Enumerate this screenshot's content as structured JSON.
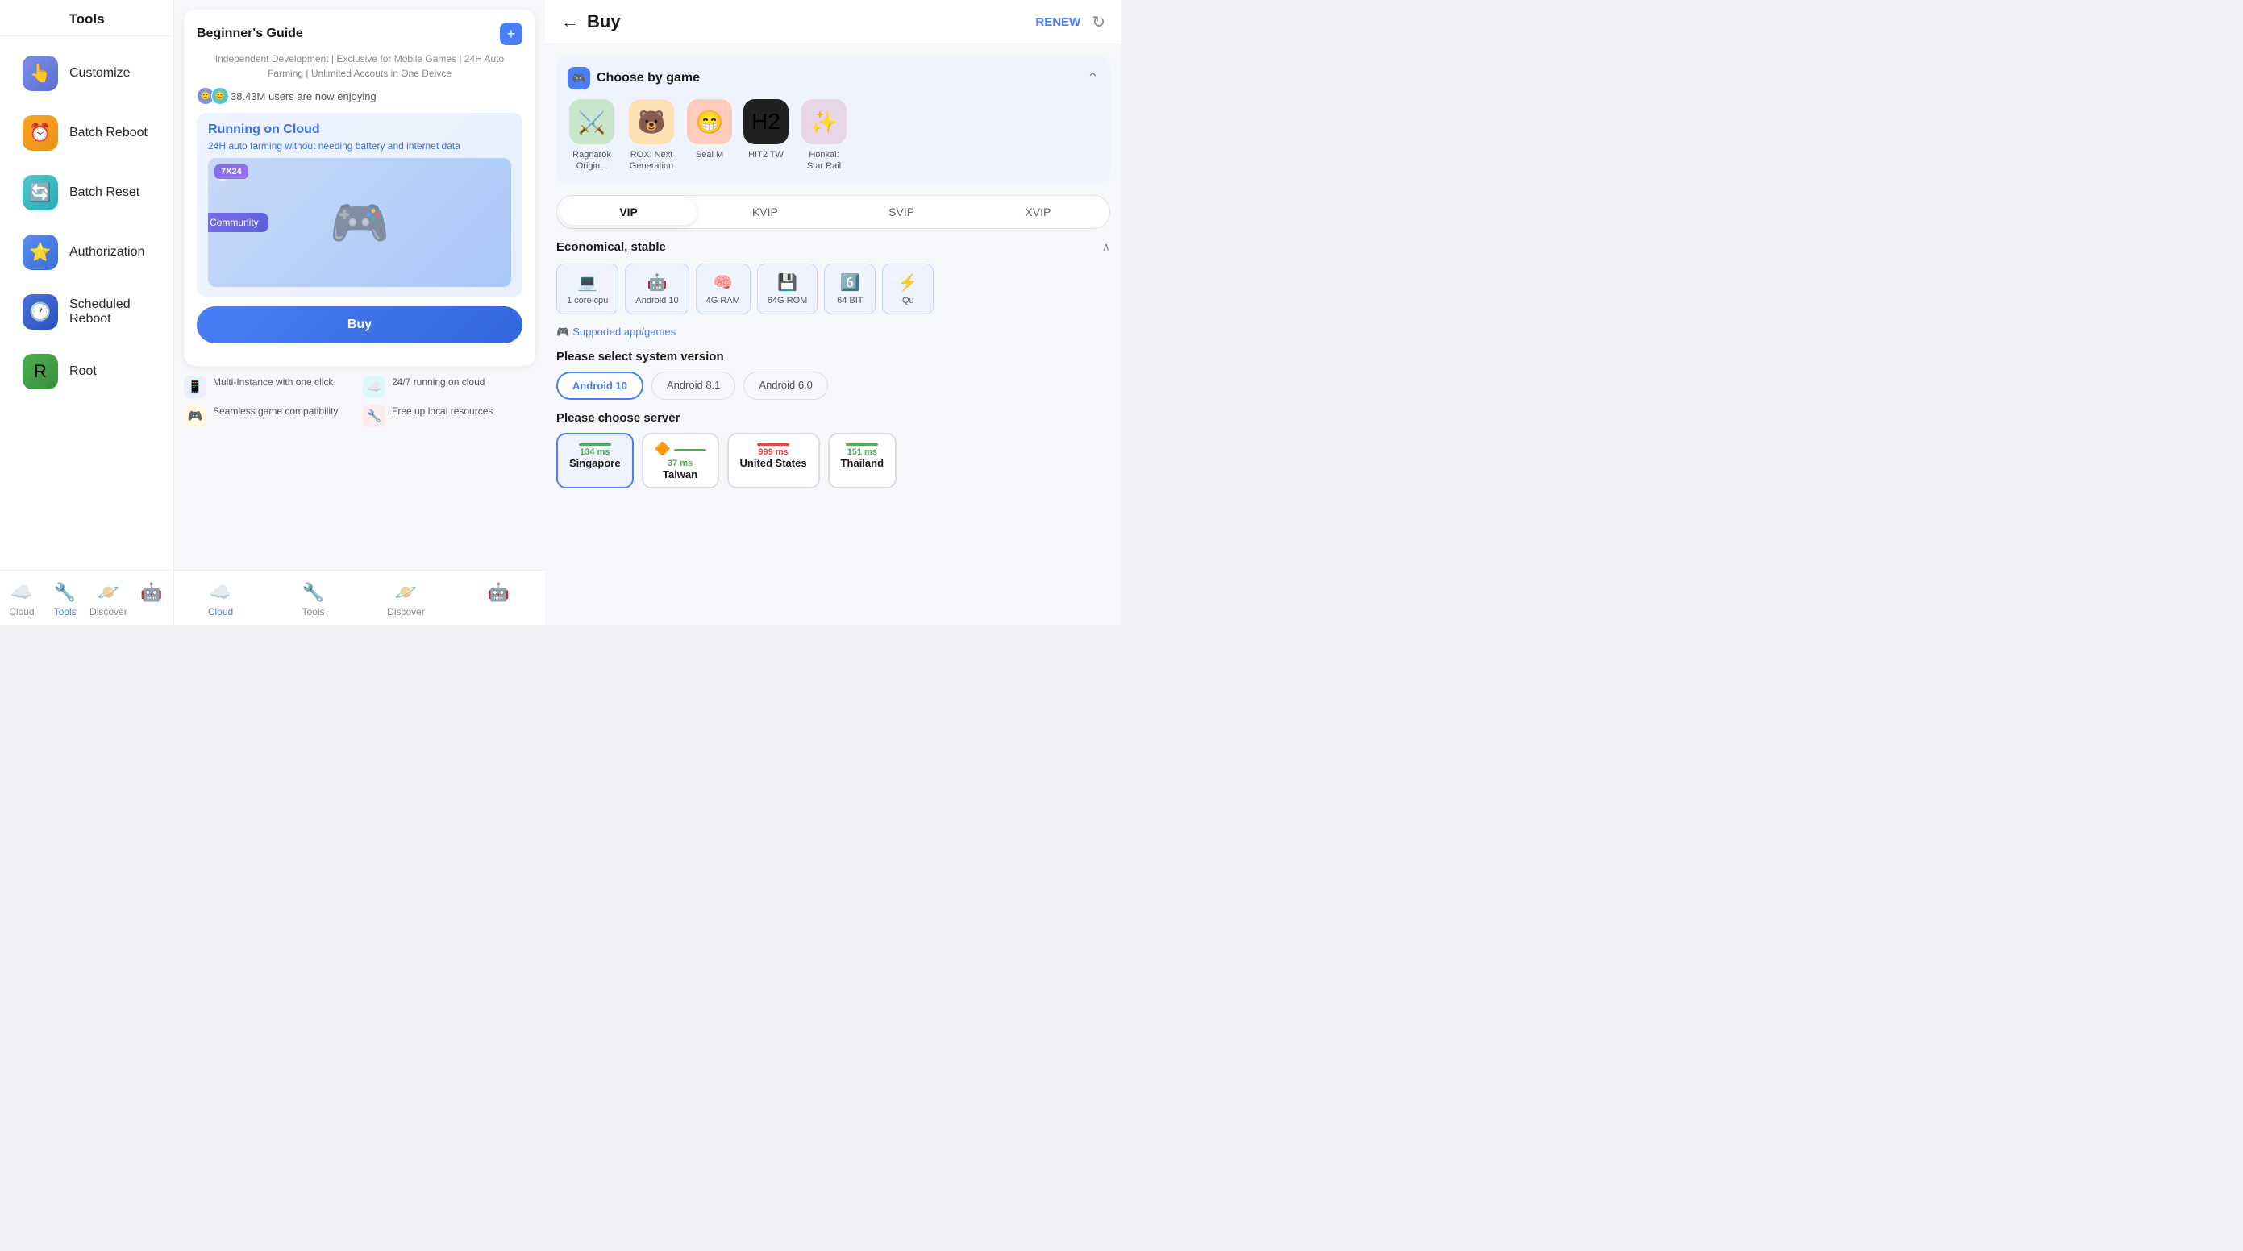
{
  "left": {
    "title": "Tools",
    "tools": [
      {
        "id": "customize",
        "label": "Customize",
        "icon": "👆",
        "iconClass": "blue-purple"
      },
      {
        "id": "batch-reboot",
        "label": "Batch Reboot",
        "icon": "⏰",
        "iconClass": "yellow"
      },
      {
        "id": "batch-reset",
        "label": "Batch Reset",
        "icon": "🔄",
        "iconClass": "teal"
      },
      {
        "id": "authorization",
        "label": "Authorization",
        "icon": "⭐",
        "iconClass": "blue"
      },
      {
        "id": "scheduled-reboot",
        "label": "Scheduled Reboot",
        "icon": "🕐",
        "iconClass": "dark-blue"
      },
      {
        "id": "root",
        "label": "Root",
        "icon": "R",
        "iconClass": "green"
      }
    ],
    "nav": [
      {
        "id": "cloud",
        "label": "Cloud",
        "icon": "☁️",
        "active": false
      },
      {
        "id": "tools",
        "label": "Tools",
        "icon": "🔧",
        "active": true
      },
      {
        "id": "discover",
        "label": "Discover",
        "icon": "🪐",
        "active": false
      },
      {
        "id": "robot",
        "label": "",
        "icon": "🤖",
        "active": false
      }
    ]
  },
  "middle": {
    "guide": {
      "title": "Beginner's Guide",
      "subtitle": "Independent Development | Exclusive for Mobile Games | 24H Auto Farming | Unlimited Accouts in One Deivce",
      "userCount": "38.43M users are now enjoying",
      "plusBtn": "+"
    },
    "banner": {
      "heading": "Running on Cloud",
      "subtext": "24H auto farming without needing battery and internet data",
      "tag": "7X24",
      "communityLabel": "Community"
    },
    "buyBtn": "Buy",
    "features": [
      {
        "icon": "📱",
        "iconClass": "blue-bg",
        "text": "Multi-Instance with one click"
      },
      {
        "icon": "☁️",
        "iconClass": "teal-bg",
        "text": "24/7 running on cloud"
      },
      {
        "icon": "🎮",
        "iconClass": "yellow-bg",
        "text": "Seamless game compatibility"
      },
      {
        "icon": "🔧",
        "iconClass": "red-bg",
        "text": "Free up local resources"
      }
    ],
    "nav": [
      {
        "id": "cloud",
        "label": "Cloud",
        "icon": "☁️",
        "active": true
      },
      {
        "id": "tools",
        "label": "Tools",
        "icon": "🔧",
        "active": false
      },
      {
        "id": "discover",
        "label": "Discover",
        "icon": "🪐",
        "active": false
      },
      {
        "id": "robot",
        "label": "",
        "icon": "🤖",
        "active": false
      }
    ]
  },
  "right": {
    "title": "Buy",
    "renewLabel": "RENEW",
    "chooseGame": {
      "title": "Choose by game",
      "games": [
        {
          "id": "ragnarok",
          "label": "Ragnarok Origin...",
          "emoji": "⚔️",
          "bg": "#C8E6C9"
        },
        {
          "id": "rox",
          "label": "ROX: Next Generation",
          "emoji": "🐻",
          "bg": "#FFE0B2"
        },
        {
          "id": "seal",
          "label": "Seal M",
          "emoji": "😁",
          "bg": "#FFCCBC"
        },
        {
          "id": "hit2tw",
          "label": "HIT2 TW",
          "emoji": "H2",
          "bg": "#212121"
        },
        {
          "id": "honkai",
          "label": "Honkai: Star Rail",
          "emoji": "✨",
          "bg": "#E8D5E8"
        }
      ]
    },
    "vipTabs": [
      {
        "id": "vip",
        "label": "VIP",
        "active": true
      },
      {
        "id": "kvip",
        "label": "KVIP",
        "active": false
      },
      {
        "id": "svip",
        "label": "SVIP",
        "active": false
      },
      {
        "id": "xvip",
        "label": "XVIP",
        "active": false
      }
    ],
    "specs": {
      "sectionLabel": "Economical, stable",
      "items": [
        {
          "id": "cpu",
          "icon": "💻",
          "label": "1 core cpu"
        },
        {
          "id": "android",
          "icon": "🤖",
          "label": "Android 10"
        },
        {
          "id": "ram",
          "icon": "🧠",
          "label": "4G RAM"
        },
        {
          "id": "rom",
          "icon": "💾",
          "label": "64G ROM"
        },
        {
          "id": "bit",
          "icon": "6️⃣",
          "label": "64 BIT"
        },
        {
          "id": "qu",
          "icon": "⚡",
          "label": "Qu"
        }
      ]
    },
    "supportedLink": "Supported app/games",
    "systemVersion": {
      "heading": "Please select system version",
      "versions": [
        {
          "label": "Android 10",
          "active": true
        },
        {
          "label": "Android 8.1",
          "active": false
        },
        {
          "label": "Android 6.0",
          "active": false
        }
      ]
    },
    "servers": {
      "heading": "Please choose server",
      "items": [
        {
          "id": "singapore",
          "name": "Singapore",
          "ping": "134 ms",
          "pingClass": "ping-green",
          "barClass": "bar-green",
          "active": true
        },
        {
          "id": "taiwan",
          "name": "Taiwan",
          "ping": "37 ms",
          "pingClass": "ping-green",
          "barClass": "bar-green",
          "flag": "🔶",
          "active": false
        },
        {
          "id": "us",
          "name": "United States",
          "ping": "999 ms",
          "pingClass": "ping-red",
          "barClass": "bar-red",
          "active": false
        },
        {
          "id": "thailand",
          "name": "Thailand",
          "ping": "151 ms",
          "pingClass": "ping-green",
          "barClass": "bar-green",
          "active": false
        }
      ]
    }
  }
}
